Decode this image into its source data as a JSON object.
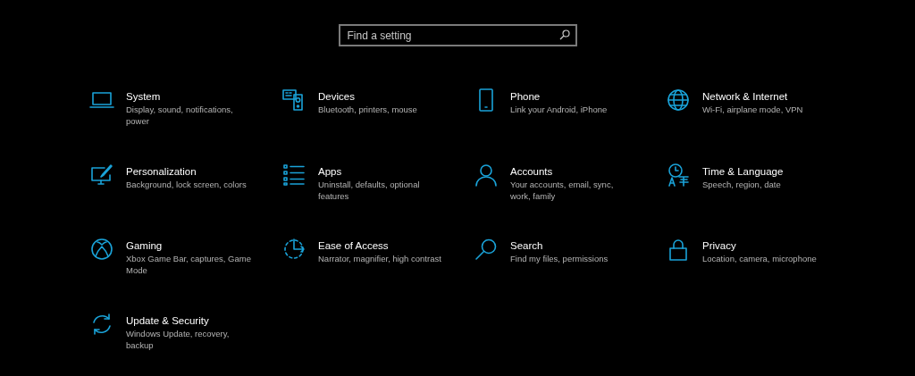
{
  "search": {
    "placeholder": "Find a setting"
  },
  "categories": [
    {
      "title": "System",
      "description": "Display, sound, notifications, power"
    },
    {
      "title": "Devices",
      "description": "Bluetooth, printers, mouse"
    },
    {
      "title": "Phone",
      "description": "Link your Android, iPhone"
    },
    {
      "title": "Network & Internet",
      "description": "Wi-Fi, airplane mode, VPN"
    },
    {
      "title": "Personalization",
      "description": "Background, lock screen, colors"
    },
    {
      "title": "Apps",
      "description": "Uninstall, defaults, optional features"
    },
    {
      "title": "Accounts",
      "description": "Your accounts, email, sync, work, family"
    },
    {
      "title": "Time & Language",
      "description": "Speech, region, date"
    },
    {
      "title": "Gaming",
      "description": "Xbox Game Bar, captures, Game Mode"
    },
    {
      "title": "Ease of Access",
      "description": "Narrator, magnifier, high contrast"
    },
    {
      "title": "Search",
      "description": "Find my files, permissions"
    },
    {
      "title": "Privacy",
      "description": "Location, camera, microphone"
    },
    {
      "title": "Update & Security",
      "description": "Windows Update, recovery, backup"
    }
  ]
}
